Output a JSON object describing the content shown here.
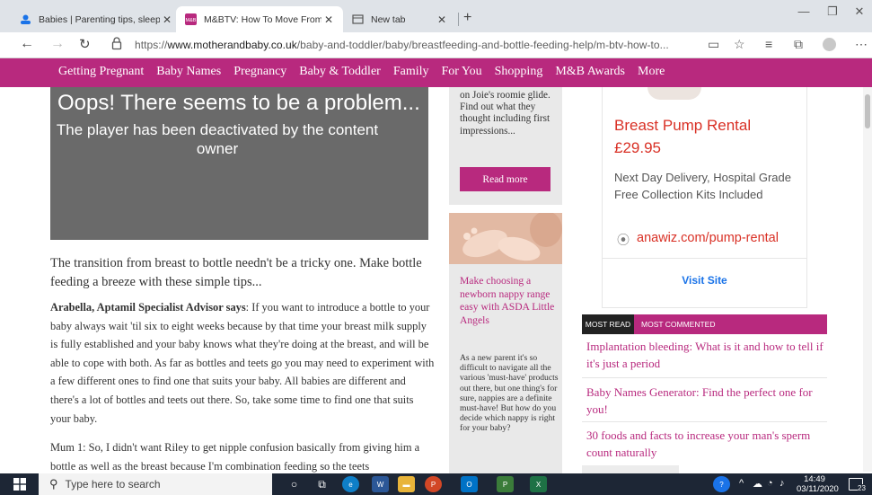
{
  "browser": {
    "tabs": [
      {
        "title": "Babies | Parenting tips, sleep and",
        "active": false
      },
      {
        "title": "M&BTV: How To Move From Bre",
        "active": true
      },
      {
        "title": "New tab",
        "active": false
      }
    ],
    "new_tab_label": "+",
    "url_prefix": "https://",
    "url_domain": "www.motherandbaby.co.uk",
    "url_path": "/baby-and-toddler/baby/breastfeeding-and-bottle-feeding-help/m-btv-how-to..."
  },
  "site_nav": [
    "Getting Pregnant",
    "Baby Names",
    "Pregnancy",
    "Baby & Toddler",
    "Family",
    "For You",
    "Shopping",
    "M&B Awards",
    "More"
  ],
  "video": {
    "error_title": "Oops! There seems to be a problem...",
    "error_message": "The player has been deactivated by the content owner"
  },
  "article": {
    "intro": "The transition from breast to bottle needn't be a tricky one. Make bottle feeding a breeze with these simple tips...",
    "para1_speaker": "Arabella, Aptamil Specialist Advisor says",
    "para1_body": ": If you want to introduce a bottle to your baby always wait 'til six to eight weeks because by that time your breast milk supply is fully established and your baby knows what they're doing at the breast, and will be able to cope with both. As far as bottles and teets go you may need to experiment with a few different ones to find one that suits your baby. All babies are different and there's a lot of bottles and teets out there. So, take some time to find one that suits your baby.",
    "para2": "Mum 1: So, I didn't want Riley to get nipple confusion basically from giving him a bottle as well as the breast because I'm combination feeding so the teets"
  },
  "promo1": {
    "text": "on Joie's roomie glide. Find out what they thought including first impressions...",
    "button": "Read more"
  },
  "promo2": {
    "title": "Make choosing a newborn nappy range easy with ASDA Little Angels",
    "text": "As a new parent it's so difficult to navigate all the various 'must-have' products out there, but one thing's for sure, nappies are a definite must-have! But how do you decide which nappy is right for your baby?"
  },
  "ad": {
    "title": "Breast Pump Rental",
    "price": "£29.95",
    "desc_line1": "Next Day Delivery, Hospital Grade",
    "desc_line2": "Free Collection Kits Included",
    "url": "anawiz.com/pump-rental",
    "cta": "Visit Site"
  },
  "most_read": {
    "tab_active": "MOST READ",
    "tab_other": "MOST COMMENTED",
    "items": [
      "Implantation bleeding: What is it and how to tell if it's just a period",
      "Baby Names Generator: Find the perfect one for you!",
      "30 foods and facts to increase your man's sperm count naturally"
    ]
  },
  "taskbar": {
    "search_placeholder": "Type here to search",
    "time": "14:49",
    "date": "03/11/2020",
    "notifications": "23"
  },
  "colors": {
    "brand": "#b8297e",
    "ad_red": "#d93025",
    "video_bg": "#6a6a6a",
    "taskbar": "#1d2635"
  }
}
